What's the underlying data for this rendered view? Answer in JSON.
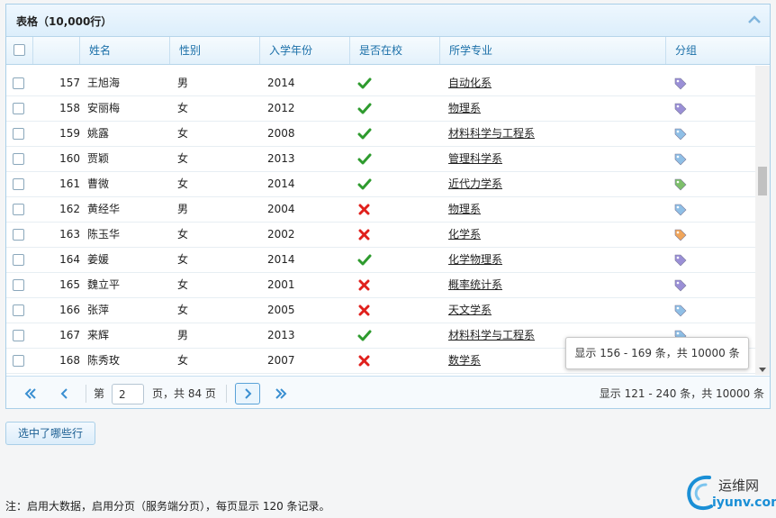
{
  "panel": {
    "title": "表格（10,000行）"
  },
  "columns": [
    "",
    "",
    "姓名",
    "性别",
    "入学年份",
    "是否在校",
    "所学专业",
    "分组"
  ],
  "rows": [
    {
      "num": "157",
      "name": "王旭海",
      "gender": "男",
      "year": "2014",
      "enrolled": "yes",
      "major": "自动化系",
      "tag": "purple"
    },
    {
      "num": "158",
      "name": "安丽梅",
      "gender": "女",
      "year": "2012",
      "enrolled": "yes",
      "major": "物理系",
      "tag": "purple"
    },
    {
      "num": "159",
      "name": "姚露",
      "gender": "女",
      "year": "2008",
      "enrolled": "yes",
      "major": "材料科学与工程系",
      "tag": "blue"
    },
    {
      "num": "160",
      "name": "贾颖",
      "gender": "女",
      "year": "2013",
      "enrolled": "yes",
      "major": "管理科学系",
      "tag": "blue"
    },
    {
      "num": "161",
      "name": "曹微",
      "gender": "女",
      "year": "2014",
      "enrolled": "yes",
      "major": "近代力学系",
      "tag": "green"
    },
    {
      "num": "162",
      "name": "黄经华",
      "gender": "男",
      "year": "2004",
      "enrolled": "no",
      "major": "物理系",
      "tag": "blue"
    },
    {
      "num": "163",
      "name": "陈玉华",
      "gender": "女",
      "year": "2002",
      "enrolled": "no",
      "major": "化学系",
      "tag": "orange"
    },
    {
      "num": "164",
      "name": "姜媛",
      "gender": "女",
      "year": "2014",
      "enrolled": "yes",
      "major": "化学物理系",
      "tag": "purple"
    },
    {
      "num": "165",
      "name": "魏立平",
      "gender": "女",
      "year": "2001",
      "enrolled": "no",
      "major": "概率统计系",
      "tag": "purple"
    },
    {
      "num": "166",
      "name": "张萍",
      "gender": "女",
      "year": "2005",
      "enrolled": "no",
      "major": "天文学系",
      "tag": "blue"
    },
    {
      "num": "167",
      "name": "来辉",
      "gender": "男",
      "year": "2013",
      "enrolled": "yes",
      "major": "材料科学与工程系",
      "tag": "blue"
    },
    {
      "num": "168",
      "name": "陈秀玫",
      "gender": "女",
      "year": "2007",
      "enrolled": "no",
      "major": "数学系",
      "tag": "purple"
    }
  ],
  "tooltip": {
    "text": "显示 156 - 169 条，共 10000 条"
  },
  "pager": {
    "page_prefix": "第",
    "page_value": "2",
    "page_suffix": "页，共 84 页",
    "summary": "显示 121 - 240 条，共 10000 条"
  },
  "select_button": "选中了哪些行",
  "note": "注：启用大数据，启用分页（服务端分页），每页显示 120 条记录。",
  "watermark": {
    "top": "运维网",
    "bottom": "iyunv.com"
  },
  "colors": {
    "check": "#2e9b2e",
    "cross": "#e0201c",
    "tag_purple": "#9a8fd6",
    "tag_blue": "#8fbfe6",
    "tag_green": "#7dbf6a",
    "tag_orange": "#f0a55a"
  }
}
